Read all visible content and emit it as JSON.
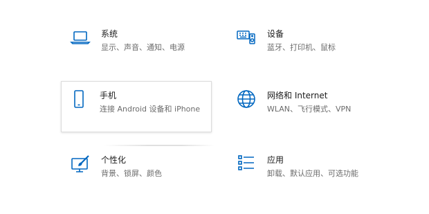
{
  "accent_color": "#0067c0",
  "tiles": [
    {
      "title": "系统",
      "desc": "显示、声音、通知、电源",
      "icon": "laptop-icon"
    },
    {
      "title": "设备",
      "desc": "蓝牙、打印机、鼠标",
      "icon": "keyboard-speaker-icon"
    },
    {
      "title": "手机",
      "desc": "连接 Android 设备和 iPhone",
      "icon": "phone-icon"
    },
    {
      "title": "网络和 Internet",
      "desc": "WLAN、飞行模式、VPN",
      "icon": "globe-icon"
    },
    {
      "title": "个性化",
      "desc": "背景、锁屏、颜色",
      "icon": "paint-brush-icon"
    },
    {
      "title": "应用",
      "desc": "卸载、默认应用、可选功能",
      "icon": "app-list-icon"
    }
  ]
}
